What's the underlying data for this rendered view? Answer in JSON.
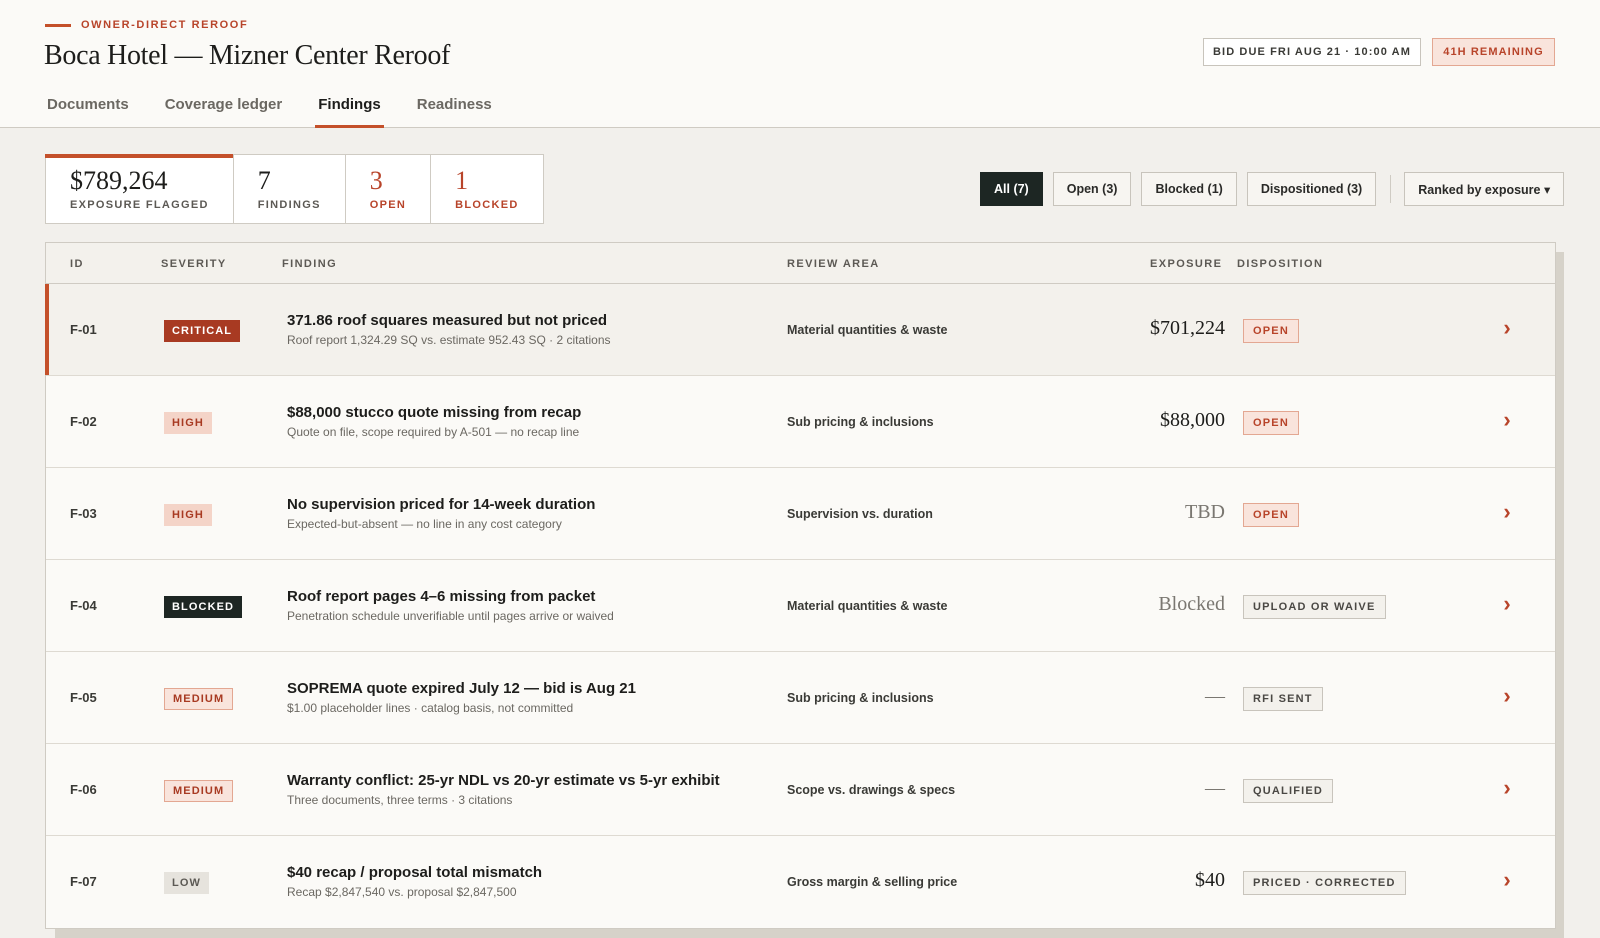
{
  "header": {
    "eyebrow": "OWNER-DIRECT REROOF",
    "title": "Boca Hotel — Mizner Center Reroof",
    "bid_due": "BID DUE FRI AUG 21 · 10:00 AM",
    "remaining": "41H REMAINING",
    "tabs": [
      {
        "label": "Documents"
      },
      {
        "label": "Coverage ledger"
      },
      {
        "label": "Findings"
      },
      {
        "label": "Readiness"
      }
    ]
  },
  "stats": {
    "exposure": {
      "value": "$789,264",
      "label": "EXPOSURE FLAGGED"
    },
    "findings": {
      "value": "7",
      "label": "FINDINGS"
    },
    "open": {
      "value": "3",
      "label": "OPEN"
    },
    "blocked": {
      "value": "1",
      "label": "BLOCKED"
    }
  },
  "filters": {
    "all": "All (7)",
    "open": "Open (3)",
    "blocked": "Blocked (1)",
    "dispositioned": "Dispositioned (3)",
    "sort": "Ranked by exposure ▾"
  },
  "table": {
    "headers": {
      "id": "ID",
      "severity": "SEVERITY",
      "finding": "FINDING",
      "area": "REVIEW AREA",
      "exposure": "EXPOSURE",
      "disposition": "DISPOSITION"
    },
    "rows": [
      {
        "id": "F-01",
        "severity": "CRITICAL",
        "title": "371.86 roof squares measured but not priced",
        "sub": "Roof report 1,324.29 SQ vs. estimate 952.43 SQ · 2 citations",
        "area": "Material quantities & waste",
        "exposure": "$701,224",
        "disposition": "OPEN"
      },
      {
        "id": "F-02",
        "severity": "HIGH",
        "title": "$88,000 stucco quote missing from recap",
        "sub": "Quote on file, scope required by A-501 — no recap line",
        "area": "Sub pricing & inclusions",
        "exposure": "$88,000",
        "disposition": "OPEN"
      },
      {
        "id": "F-03",
        "severity": "HIGH",
        "title": "No supervision priced for 14-week duration",
        "sub": "Expected-but-absent — no line in any cost category",
        "area": "Supervision vs. duration",
        "exposure": "TBD",
        "disposition": "OPEN"
      },
      {
        "id": "F-04",
        "severity": "BLOCKED",
        "title": "Roof report pages 4–6 missing from packet",
        "sub": "Penetration schedule unverifiable until pages arrive or waived",
        "area": "Material quantities & waste",
        "exposure": "Blocked",
        "disposition": "UPLOAD OR WAIVE"
      },
      {
        "id": "F-05",
        "severity": "MEDIUM",
        "title": "SOPREMA quote expired July 12 — bid is Aug 21",
        "sub": "$1.00 placeholder lines · catalog basis, not committed",
        "area": "Sub pricing & inclusions",
        "exposure": "—",
        "disposition": "RFI SENT"
      },
      {
        "id": "F-06",
        "severity": "MEDIUM",
        "title": "Warranty conflict: 25-yr NDL vs 20-yr estimate vs 5-yr exhibit",
        "sub": "Three documents, three terms · 3 citations",
        "area": "Scope vs. drawings & specs",
        "exposure": "—",
        "disposition": "QUALIFIED"
      },
      {
        "id": "F-07",
        "severity": "LOW",
        "title": "$40 recap / proposal total mismatch",
        "sub": "Recap $2,847,540 vs. proposal $2,847,500",
        "area": "Gross margin & selling price",
        "exposure": "$40",
        "disposition": "PRICED · CORRECTED"
      }
    ]
  },
  "colors": {
    "accent": "#c4502a",
    "critical": "#a83a22",
    "dark": "#1d2623"
  }
}
